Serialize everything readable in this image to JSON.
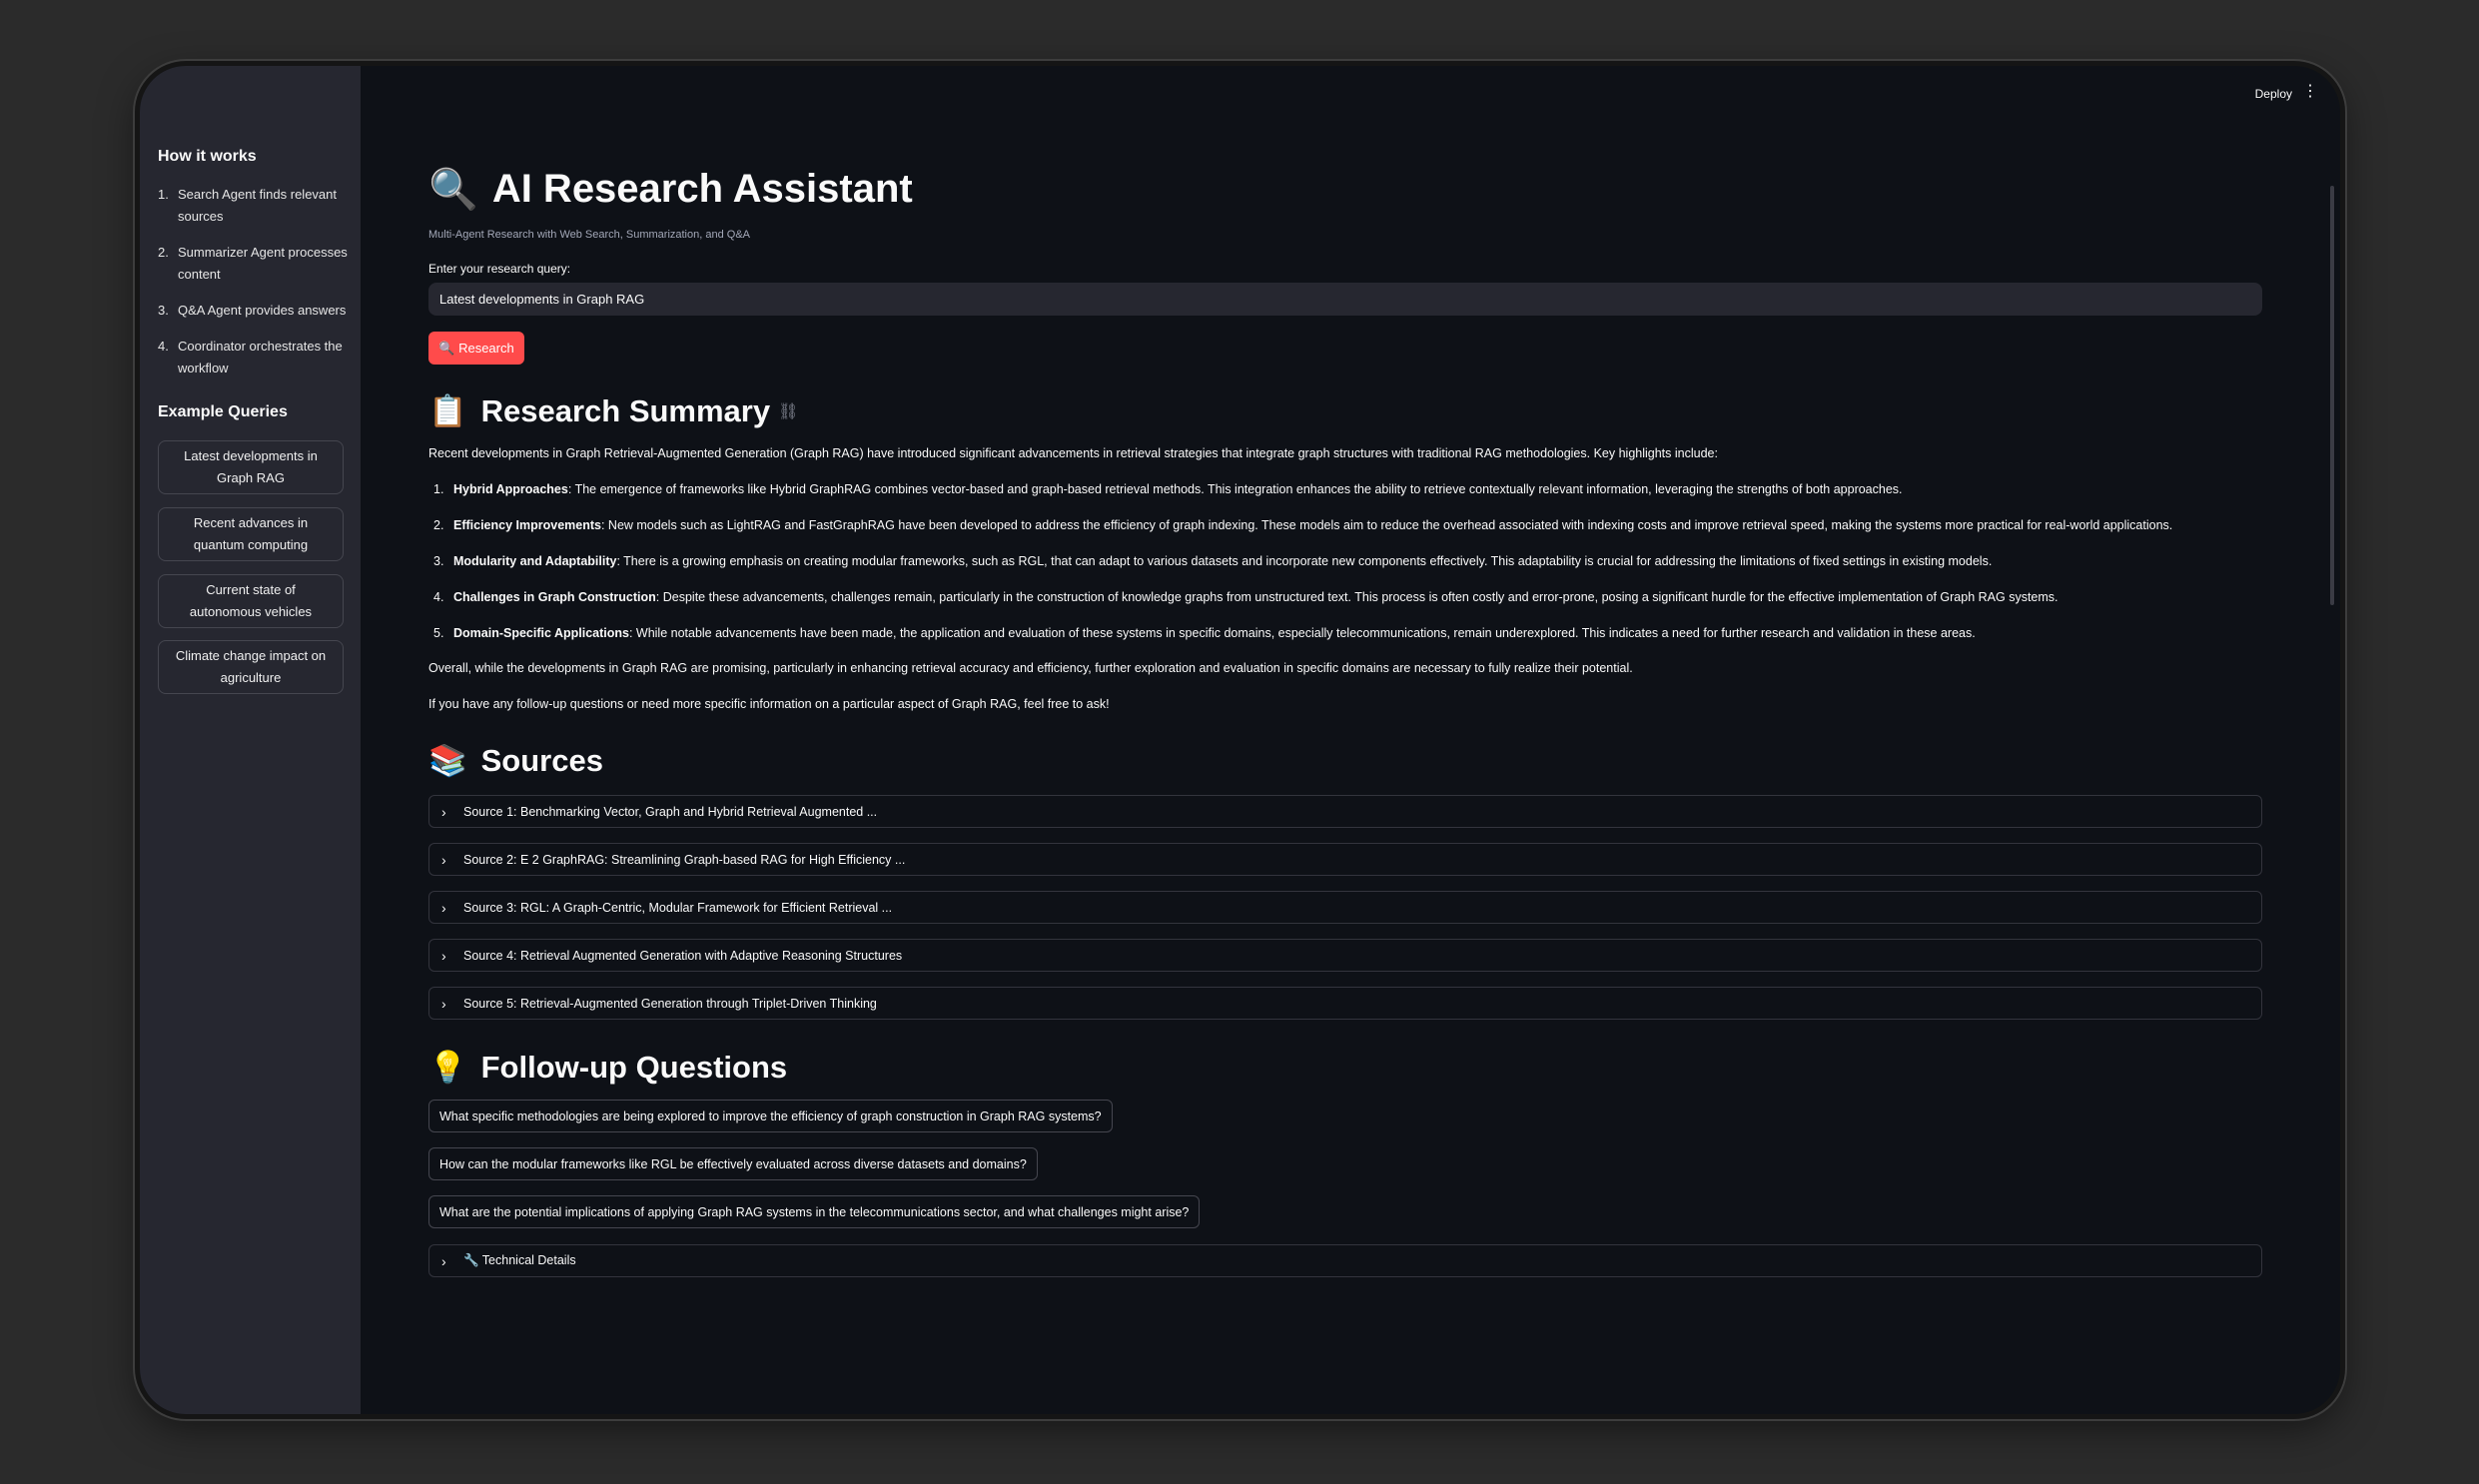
{
  "topbar": {
    "deploy_label": "Deploy",
    "menu_icon": "⋮"
  },
  "sidebar": {
    "how_title": "How it works",
    "steps": [
      {
        "n": "1.",
        "text": "Search Agent finds relevant sources"
      },
      {
        "n": "2.",
        "text": "Summarizer Agent processes content"
      },
      {
        "n": "3.",
        "text": "Q&A Agent provides answers"
      },
      {
        "n": "4.",
        "text": "Coordinator orchestrates the workflow"
      }
    ],
    "examples_title": "Example Queries",
    "examples": [
      "Latest developments in Graph RAG",
      "Recent advances in quantum computing",
      "Current state of autonomous vehicles",
      "Climate change impact on agriculture"
    ]
  },
  "main": {
    "title_emoji": "🔍",
    "title": "AI Research Assistant",
    "subtitle": "Multi-Agent Research with Web Search, Summarization, and Q&A",
    "query_label": "Enter your research query:",
    "query_value": "Latest developments in Graph RAG",
    "research_button": "🔍 Research",
    "summary_emoji": "📋",
    "summary_title": "Research Summary",
    "summary_intro": "Recent developments in Graph Retrieval-Augmented Generation (Graph RAG) have introduced significant advancements in retrieval strategies that integrate graph structures with traditional RAG methodologies. Key highlights include:",
    "summary_items": [
      {
        "n": "1.",
        "bold": "Hybrid Approaches",
        "text": ": The emergence of frameworks like Hybrid GraphRAG combines vector-based and graph-based retrieval methods. This integration enhances the ability to retrieve contextually relevant information, leveraging the strengths of both approaches."
      },
      {
        "n": "2.",
        "bold": "Efficiency Improvements",
        "text": ": New models such as LightRAG and FastGraphRAG have been developed to address the efficiency of graph indexing. These models aim to reduce the overhead associated with indexing costs and improve retrieval speed, making the systems more practical for real-world applications."
      },
      {
        "n": "3.",
        "bold": "Modularity and Adaptability",
        "text": ": There is a growing emphasis on creating modular frameworks, such as RGL, that can adapt to various datasets and incorporate new components effectively. This adaptability is crucial for addressing the limitations of fixed settings in existing models."
      },
      {
        "n": "4.",
        "bold": "Challenges in Graph Construction",
        "text": ": Despite these advancements, challenges remain, particularly in the construction of knowledge graphs from unstructured text. This process is often costly and error-prone, posing a significant hurdle for the effective implementation of Graph RAG systems."
      },
      {
        "n": "5.",
        "bold": "Domain-Specific Applications",
        "text": ": While notable advancements have been made, the application and evaluation of these systems in specific domains, especially telecommunications, remain underexplored. This indicates a need for further research and validation in these areas."
      }
    ],
    "summary_overall": "Overall, while the developments in Graph RAG are promising, particularly in enhancing retrieval accuracy and efficiency, further exploration and evaluation in specific domains are necessary to fully realize their potential.",
    "summary_followup": "If you have any follow-up questions or need more specific information on a particular aspect of Graph RAG, feel free to ask!",
    "sources_emoji": "📚",
    "sources_title": "Sources",
    "sources": [
      "Source 1: Benchmarking Vector, Graph and Hybrid Retrieval Augmented ...",
      "Source 2: E 2 GraphRAG: Streamlining Graph-based RAG for High Efficiency ...",
      "Source 3: RGL: A Graph-Centric, Modular Framework for Efficient Retrieval ...",
      "Source 4: Retrieval Augmented Generation with Adaptive Reasoning Structures",
      "Source 5: Retrieval-Augmented Generation through Triplet-Driven Thinking"
    ],
    "followup_emoji": "💡",
    "followup_title": "Follow-up Questions",
    "followup_questions": [
      "What specific methodologies are being explored to improve the efficiency of graph construction in Graph RAG systems?",
      "How can the modular frameworks like RGL be effectively evaluated across diverse datasets and domains?",
      "What are the potential implications of applying Graph RAG systems in the telecommunications sector, and what challenges might arise?"
    ],
    "technical_label": "🔧 Technical Details"
  }
}
